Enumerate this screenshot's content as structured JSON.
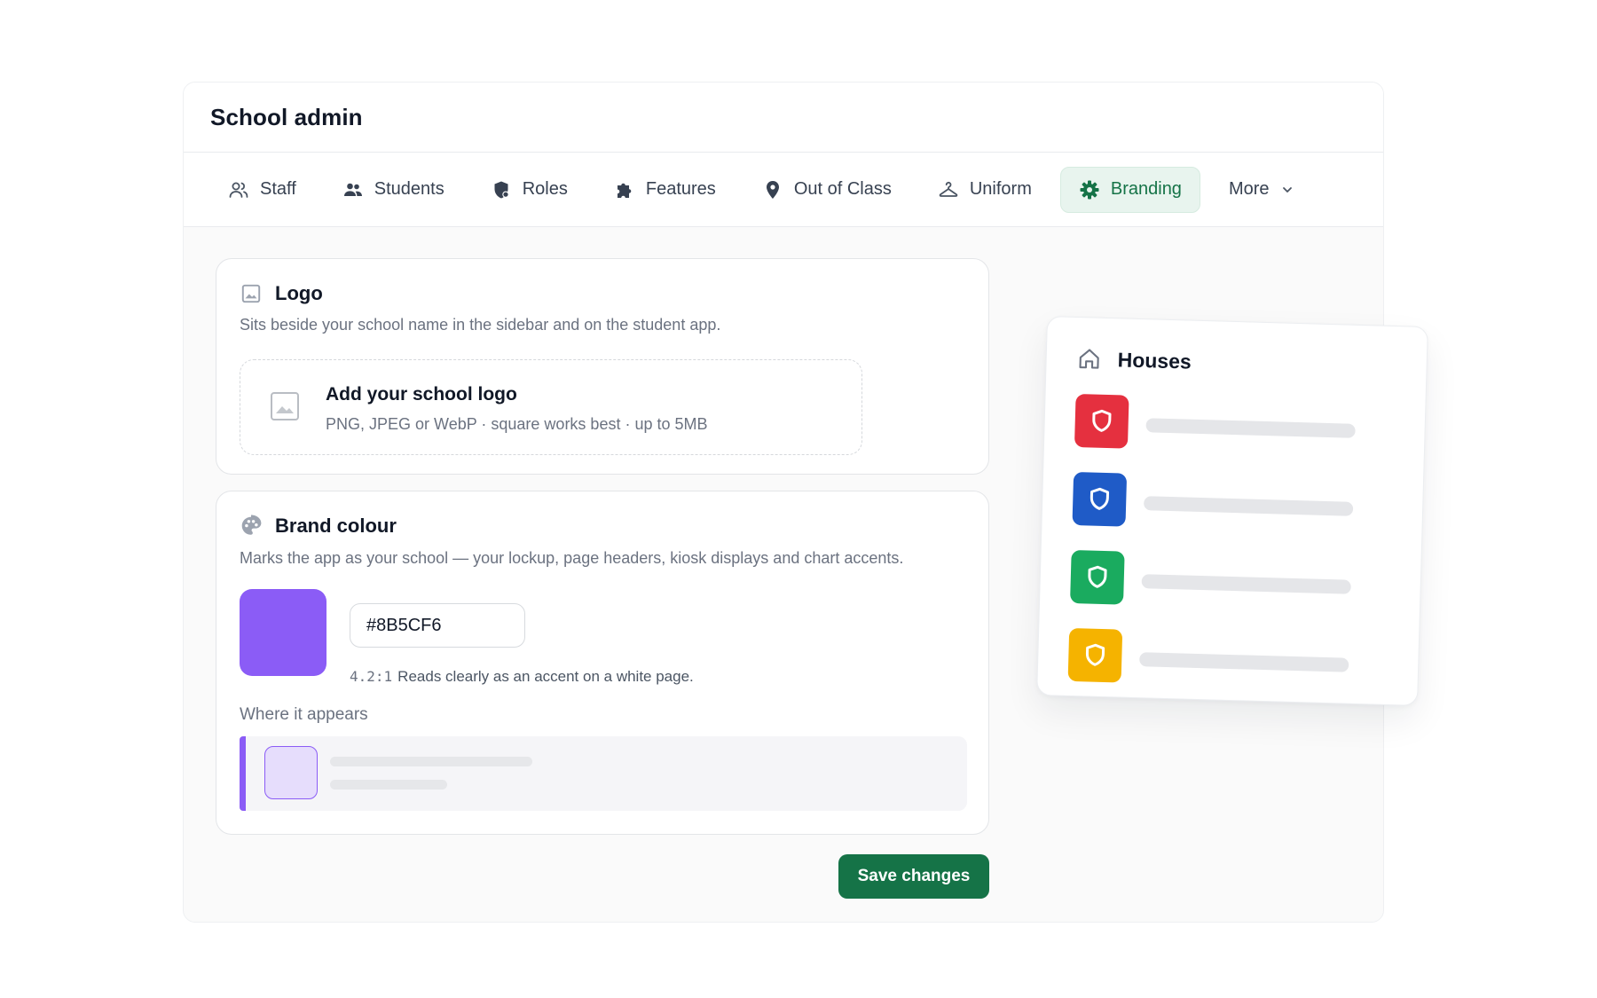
{
  "app": {
    "title": "School admin"
  },
  "tabs": [
    {
      "label": "Staff",
      "icon": "staff-icon",
      "active": false
    },
    {
      "label": "Students",
      "icon": "students-icon",
      "active": false
    },
    {
      "label": "Roles",
      "icon": "shield-icon",
      "active": false
    },
    {
      "label": "Features",
      "icon": "puzzle-icon",
      "active": false
    },
    {
      "label": "Out of Class",
      "icon": "location-pin-icon",
      "active": false
    },
    {
      "label": "Uniform",
      "icon": "hanger-icon",
      "active": false
    },
    {
      "label": "Branding",
      "icon": "gear-icon",
      "active": true
    },
    {
      "label": "More",
      "icon": "chevron-down-icon",
      "active": false
    }
  ],
  "logo_card": {
    "title": "Logo",
    "description": "Sits beside your school name in the sidebar and on the student app.",
    "dropzone_title": "Add your school logo",
    "dropzone_hint": "PNG, JPEG or WebP · square works best · up to 5MB"
  },
  "brand_card": {
    "title": "Brand colour",
    "description": "Marks the app as your school — your lockup, page headers, kiosk displays and chart accents.",
    "hex_value": "#8B5CF6",
    "contrast_ratio": "4.2:1",
    "contrast_note": "Reads clearly as an accent on a white page.",
    "where_label": "Where it appears"
  },
  "actions": {
    "save_label": "Save changes"
  },
  "houses": {
    "title": "Houses",
    "items": [
      {
        "color": "#E5303F"
      },
      {
        "color": "#1F5BC7"
      },
      {
        "color": "#1AAB5F"
      },
      {
        "color": "#F5B300"
      }
    ]
  },
  "colors": {
    "brand_primary": "#157347",
    "brand_active_bg": "#E8F4EE",
    "accent_swatch": "#8B5CF6",
    "accent_light": "#E6DDFC"
  }
}
